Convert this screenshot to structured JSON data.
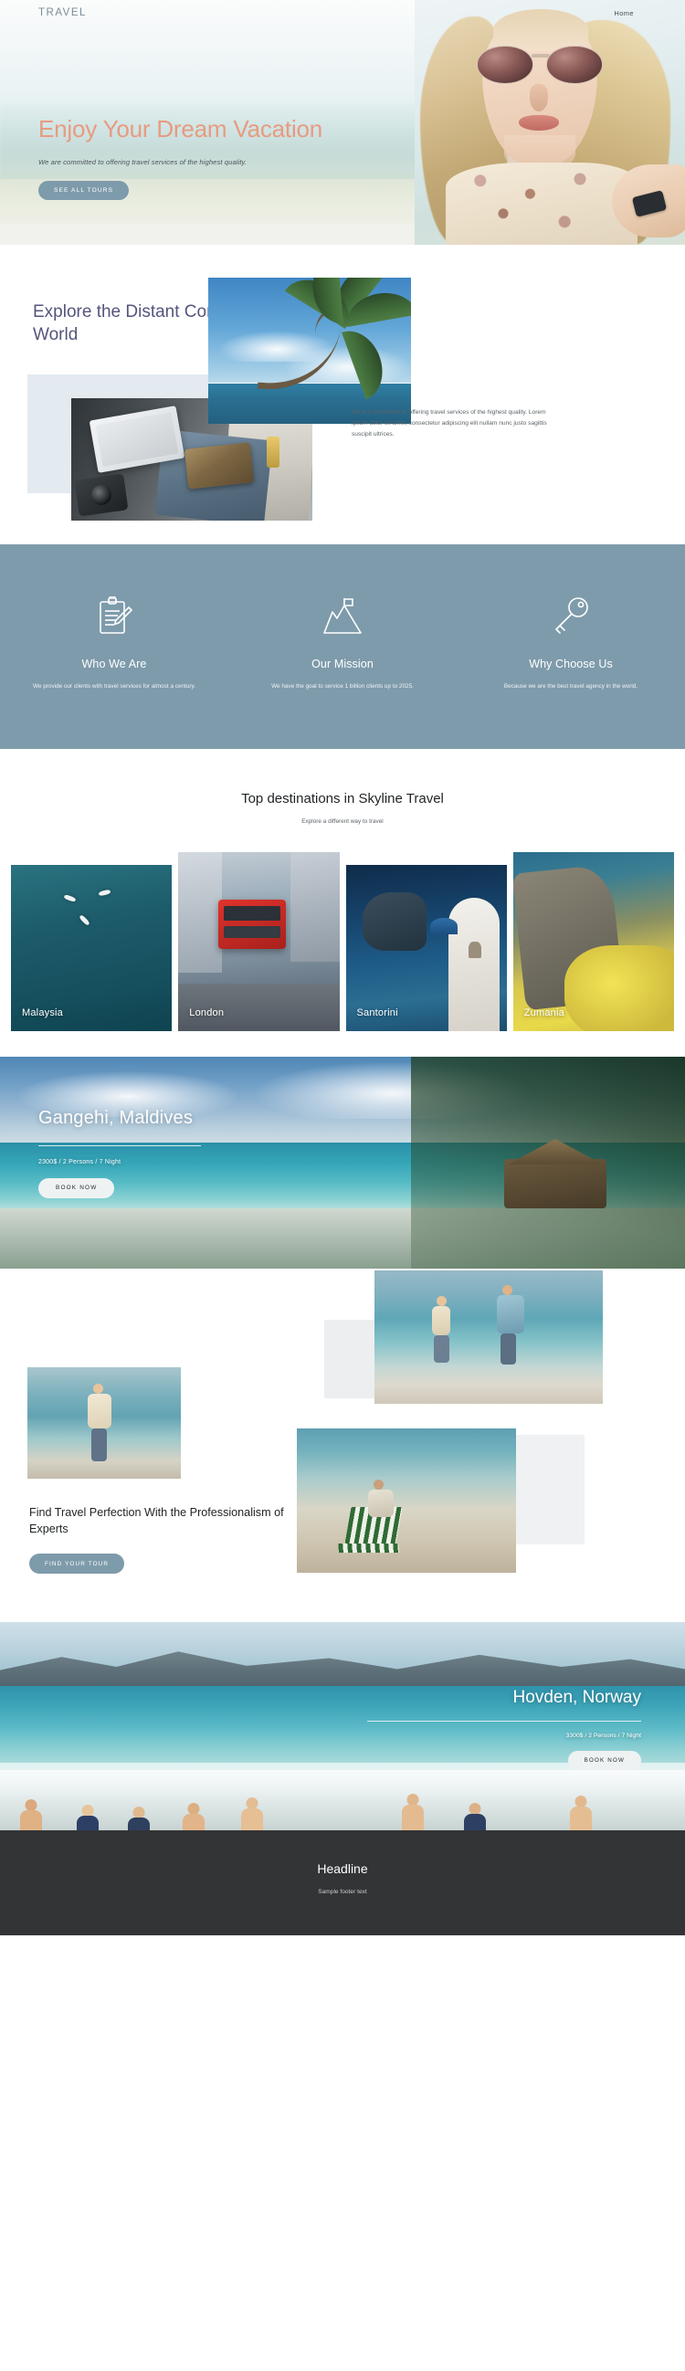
{
  "nav": {
    "logo": "TRAVEL",
    "links": [
      {
        "label": "Home"
      }
    ]
  },
  "hero": {
    "title": "Enjoy Your Dream Vacation",
    "subtitle": "We are committed to offering travel services of the highest quality.",
    "cta": "SEE ALL TOURS",
    "title_color": "#e79b80",
    "cta_color": "#7e9bab"
  },
  "explore": {
    "title": "Explore the Distant Corners of the World",
    "title_color": "#54557d",
    "paragraph": "We are committed to offering travel services of the highest quality. Lorem ipsum dolor sit amet, consectetur adipiscing elit nullam nunc justo sagittis suscipit ultrices."
  },
  "features": {
    "background": "#7e9bab",
    "items": [
      {
        "icon": "clipboard-pencil-icon",
        "title": "Who We Are",
        "desc": "We provide our clients with travel services for almost a century."
      },
      {
        "icon": "mountain-flag-icon",
        "title": "Our Mission",
        "desc": "We have the goal to service 1 billion clients up to 2025."
      },
      {
        "icon": "key-icon",
        "title": "Why Choose Us",
        "desc": "Because we are the best travel agency in the world."
      }
    ]
  },
  "destinations": {
    "title": "Top destinations in Skyline Travel",
    "subtitle": "Explore a different way to travel",
    "cards": [
      {
        "label": "Malaysia"
      },
      {
        "label": "London"
      },
      {
        "label": "Santorini"
      },
      {
        "label": "Zumania"
      }
    ]
  },
  "maldives": {
    "title": "Gangehi, Maldives",
    "meta": "2300$ / 2 Persons / 7 Night",
    "cta": "BOOK NOW"
  },
  "perfection": {
    "title": "Find Travel Perfection With the Professionalism of Experts",
    "cta": "FIND YOUR TOUR"
  },
  "norway": {
    "title": "Hovden, Norway",
    "meta": "3300$ / 2 Persons / 7 Night",
    "cta": "BOOK NOW"
  },
  "footer": {
    "title": "Headline",
    "text": "Sample footer text",
    "background": "#333436"
  }
}
